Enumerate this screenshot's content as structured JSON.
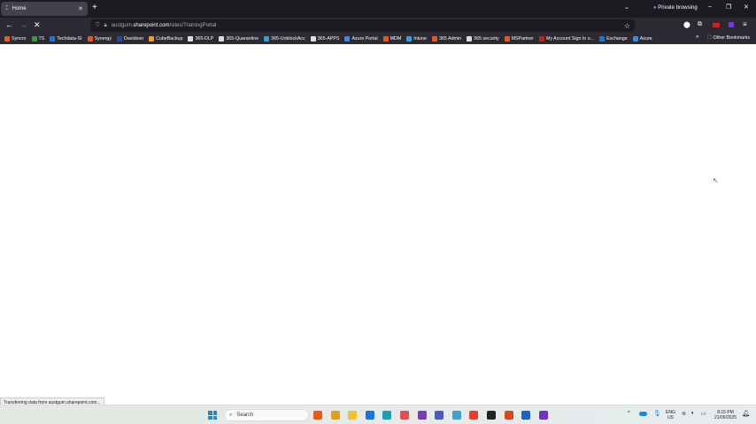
{
  "tab": {
    "title": "Home"
  },
  "window": {
    "private_label": "Private browsing"
  },
  "address": {
    "prefix": "austgum.",
    "domain": "sharepoint.com",
    "path": "/sites/TrainingPortal"
  },
  "bookmarks": [
    {
      "label": "Syncro",
      "color": "#e8591a"
    },
    {
      "label": "TS",
      "color": "#3a9a3a"
    },
    {
      "label": "Techdata-SI",
      "color": "#1e73d8"
    },
    {
      "label": "Synergy",
      "color": "#e8591a"
    },
    {
      "label": "Davidson",
      "color": "#2a4a9a"
    },
    {
      "label": "CubeBackup",
      "color": "#f0a020"
    },
    {
      "label": "365-DLP",
      "color": "#dddddd"
    },
    {
      "label": "365-Quarantine",
      "color": "#dddddd"
    },
    {
      "label": "365-UnblockAcc",
      "color": "#2aa0e0"
    },
    {
      "label": "365-APPS",
      "color": "#dddddd"
    },
    {
      "label": "Azure Portal",
      "color": "#3a8ae0"
    },
    {
      "label": "MDM",
      "color": "#f25022"
    },
    {
      "label": "Intune",
      "color": "#2aa0e0"
    },
    {
      "label": "365 Admin",
      "color": "#f25022"
    },
    {
      "label": "365 security",
      "color": "#dddddd"
    },
    {
      "label": "MSPartner",
      "color": "#f25022"
    },
    {
      "label": "My Account  Sign In o...",
      "color": "#c02020"
    },
    {
      "label": "Exchange",
      "color": "#1e73d8"
    },
    {
      "label": "Azure",
      "color": "#3a8ae0"
    }
  ],
  "other_bookmarks": "Other Bookmarks",
  "status_text": "Transferring data from austgum.sharepoint.com...",
  "taskbar": {
    "search_label": "Search",
    "lang": "ENG",
    "region": "US",
    "time": "8:15 PM",
    "date": "21/09/2025",
    "apps": [
      {
        "name": "firefox",
        "color": "#e8591a"
      },
      {
        "name": "chrome",
        "color": "#e0a020"
      },
      {
        "name": "file-explorer",
        "color": "#f0c030"
      },
      {
        "name": "outlook",
        "color": "#1e73d8"
      },
      {
        "name": "edge",
        "color": "#1aa0b0"
      },
      {
        "name": "snipping-tool",
        "color": "#e05050"
      },
      {
        "name": "onenote",
        "color": "#7a3ab0"
      },
      {
        "name": "teams",
        "color": "#5058c0"
      },
      {
        "name": "notepad",
        "color": "#40a0d0"
      },
      {
        "name": "chrome-profile",
        "color": "#e04030"
      },
      {
        "name": "app-dark",
        "color": "#222222"
      },
      {
        "name": "powerpoint",
        "color": "#d04a20"
      },
      {
        "name": "word",
        "color": "#2060c0"
      },
      {
        "name": "app-purple",
        "color": "#7030c0"
      }
    ]
  }
}
